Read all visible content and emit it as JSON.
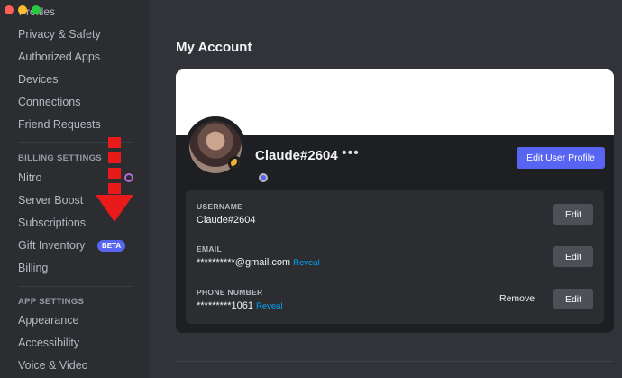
{
  "sidebar": {
    "cut_label": "Profiles",
    "items_top": [
      {
        "label": "Privacy & Safety"
      },
      {
        "label": "Authorized Apps"
      },
      {
        "label": "Devices"
      },
      {
        "label": "Connections"
      },
      {
        "label": "Friend Requests"
      }
    ],
    "billing_heading": "BILLING SETTINGS",
    "billing_items": [
      {
        "label": "Nitro",
        "icon": "nitro-icon"
      },
      {
        "label": "Server Boost"
      },
      {
        "label": "Subscriptions"
      },
      {
        "label": "Gift Inventory",
        "badge": "BETA"
      },
      {
        "label": "Billing"
      }
    ],
    "app_heading": "APP SETTINGS",
    "app_items": [
      {
        "label": "Appearance"
      },
      {
        "label": "Accessibility"
      },
      {
        "label": "Voice & Video"
      }
    ]
  },
  "main": {
    "title": "My Account",
    "profile": {
      "display_name": "Claude#2604",
      "more": "•••",
      "edit_profile_label": "Edit User Profile"
    },
    "fields": {
      "username": {
        "label": "USERNAME",
        "value": "Claude#2604",
        "edit": "Edit"
      },
      "email": {
        "label": "EMAIL",
        "value": "**********@gmail.com",
        "reveal": "Reveal",
        "edit": "Edit"
      },
      "phone": {
        "label": "PHONE NUMBER",
        "value": "*********1061",
        "reveal": "Reveal",
        "remove": "Remove",
        "edit": "Edit"
      }
    }
  },
  "colors": {
    "accent": "#5865f2",
    "annotation_arrow": "#e81a1a",
    "link": "#00a8fc"
  }
}
